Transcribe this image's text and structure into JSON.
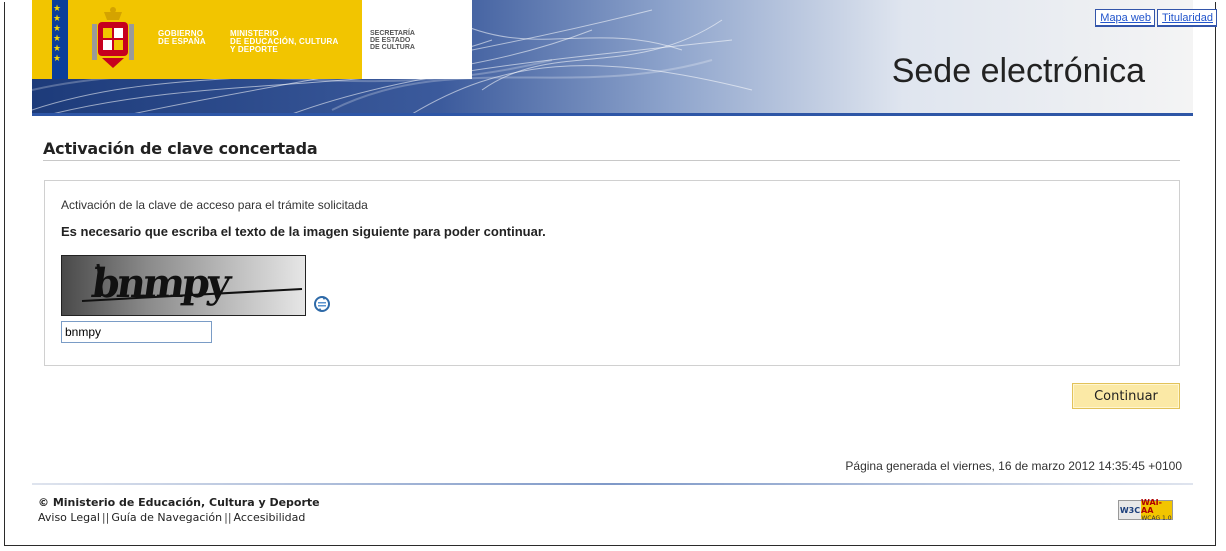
{
  "header": {
    "gov_line1": "GOBIERNO",
    "gov_line2": "DE ESPAÑA",
    "ministry_line1": "MINISTERIO",
    "ministry_line2": "DE EDUCACIÓN, CULTURA",
    "ministry_line3": "Y DEPORTE",
    "secretaria_line1": "SECRETARÍA",
    "secretaria_line2": "DE ESTADO",
    "secretaria_line3": "DE CULTURA",
    "title": "Sede electrónica",
    "links": [
      "Mapa web",
      "Titularidad"
    ]
  },
  "main": {
    "page_title": "Activación de clave concertada",
    "intro": "Activación de la clave de acceso para el trámite solicitada",
    "instruction": "Es necesario que escriba el texto de la imagen siguiente para poder continuar.",
    "captcha_text": "bnmpy",
    "captcha_input_value": "bnmpy",
    "continue_label": "Continuar",
    "generated": "Página generada el viernes, 16 de marzo 2012 14:35:45 +0100"
  },
  "footer": {
    "copyright": "© Ministerio de Educación, Cultura y Deporte",
    "links": [
      "Aviso Legal",
      "Guía de Navegación",
      "Accesibilidad"
    ],
    "badge_w3c": "W3C",
    "badge_level": "WAI-AA",
    "badge_version": "WCAG 1.0"
  },
  "colors": {
    "accent_blue": "#2e56a6",
    "gov_yellow": "#f2c500",
    "button_yellow": "#fbe9a6"
  },
  "icons": {
    "refresh": "refresh-icon",
    "coat_of_arms": "coat-of-arms-icon"
  }
}
